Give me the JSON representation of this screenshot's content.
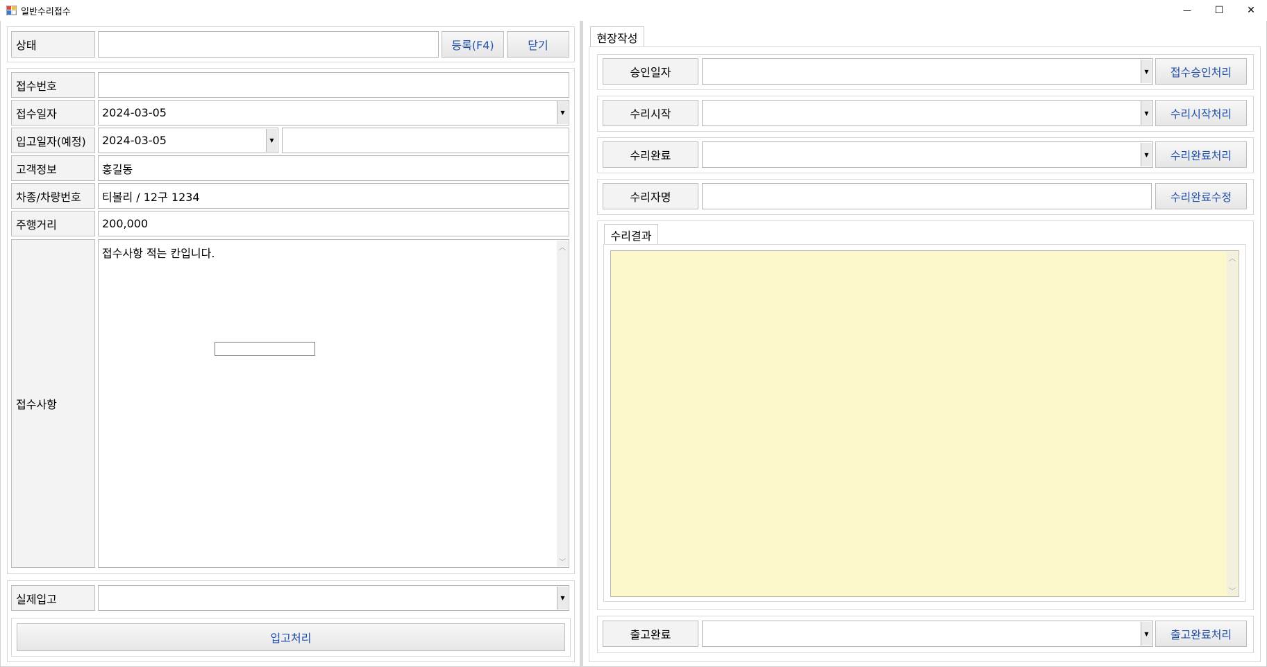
{
  "window": {
    "title": "일반수리접수",
    "minimize": "—",
    "maximize": "☐",
    "close": "✕"
  },
  "left": {
    "status": {
      "label": "상태",
      "value": ""
    },
    "register_button": "등록(F4)",
    "close_button": "닫기",
    "receipt_no": {
      "label": "접수번호",
      "value": ""
    },
    "receipt_date": {
      "label": "접수일자",
      "value": "2024-03-05"
    },
    "expected_in_date": {
      "label": "입고일자(예정)",
      "value": "2024-03-05",
      "extra": ""
    },
    "customer": {
      "label": "고객정보",
      "value": "홍길동"
    },
    "vehicle": {
      "label": "차종/차량번호",
      "value": "티볼리 / 12구 1234"
    },
    "mileage": {
      "label": "주행거리",
      "value": "200,000"
    },
    "notes": {
      "label": "접수사항",
      "value": "접수사항 적는 칸입니다."
    },
    "actual_in": {
      "label": "실제입고",
      "value": ""
    },
    "in_process_button": "입고처리"
  },
  "right": {
    "tab": "현장작성",
    "approval_date": {
      "label": "승인일자",
      "value": "",
      "button": "접수승인처리"
    },
    "repair_start": {
      "label": "수리시작",
      "value": "",
      "button": "수리시작처리"
    },
    "repair_done": {
      "label": "수리완료",
      "value": "",
      "button": "수리완료처리"
    },
    "repairer": {
      "label": "수리자명",
      "value": "",
      "button": "수리완료수정"
    },
    "result_tab": "수리결과",
    "result_value": "",
    "release_done": {
      "label": "출고완료",
      "value": "",
      "button": "출고완료처리"
    }
  },
  "colors": {
    "result_bg": "#fdf8cc",
    "button_text": "#1f4fa8"
  },
  "icons": {
    "app": "app-form-icon",
    "dropdown": "dropdown-arrow-icon",
    "scroll_up": "scroll-up-icon",
    "scroll_down": "scroll-down-icon"
  }
}
